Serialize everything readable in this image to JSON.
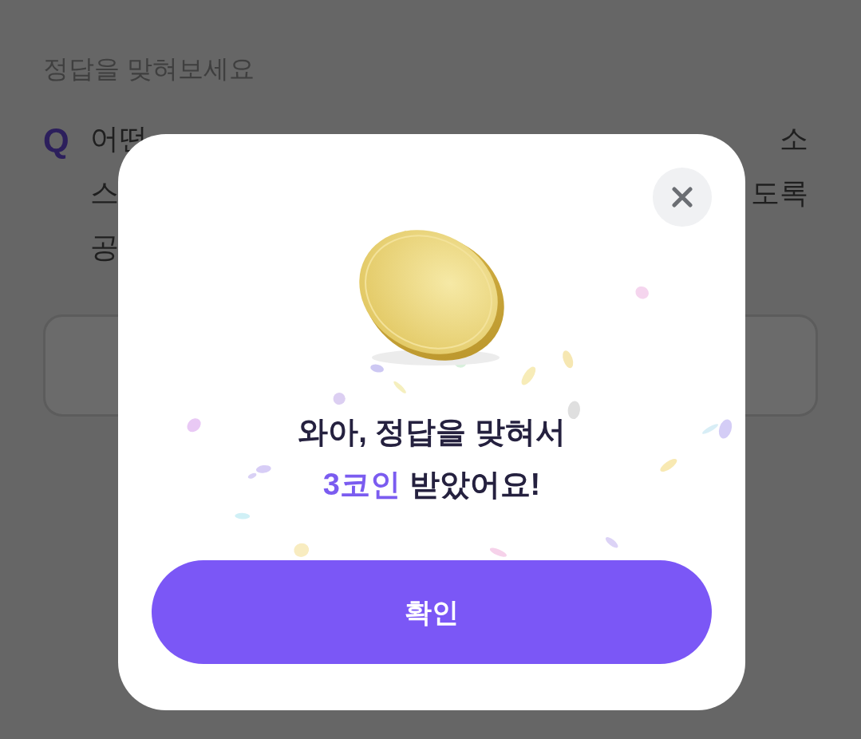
{
  "page": {
    "heading": "정답을 맞혀보세요",
    "question_mark": "Q",
    "question_lines": [
      [
        "어떤",
        "소"
      ],
      [
        "스",
        "도록"
      ],
      [
        "공"
      ]
    ]
  },
  "dialog": {
    "message_line1": "와아, 정답을 맞혀서",
    "message_line2": [
      {
        "text": "3코인",
        "highlight": true
      },
      {
        "text": " 받았어요!",
        "highlight": false
      }
    ],
    "confirm_button": "확인"
  }
}
